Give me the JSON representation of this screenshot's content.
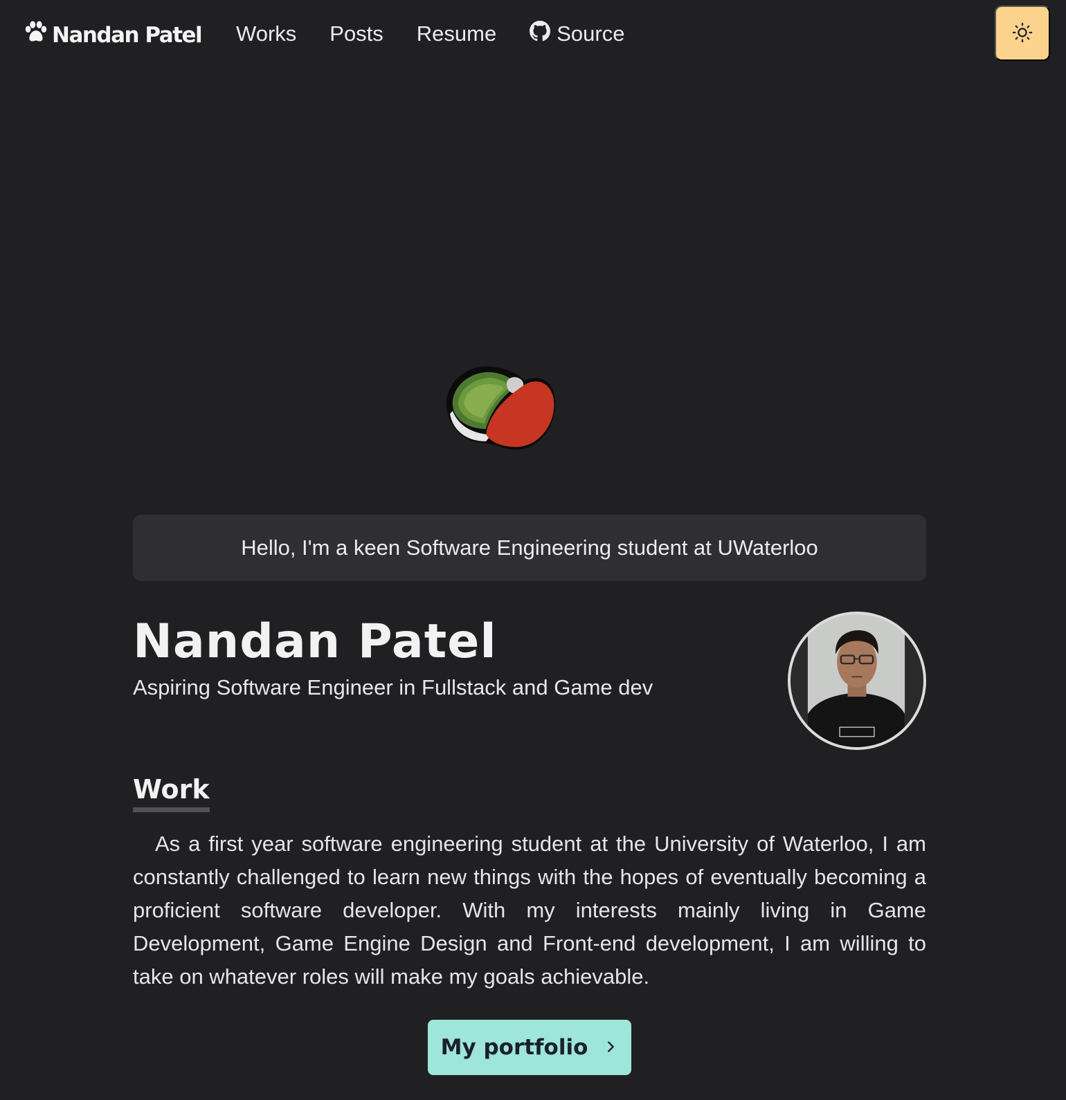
{
  "nav": {
    "logo_text": "Nandan Patel",
    "logo_icon": "paw-icon",
    "links": [
      {
        "label": "Works"
      },
      {
        "label": "Posts"
      },
      {
        "label": "Resume"
      },
      {
        "label": "Source",
        "icon": "github-icon"
      }
    ],
    "theme_toggle_icon": "sun-icon"
  },
  "hero": {
    "greeting": "Hello, I'm a keen Software Engineering student at UWaterloo"
  },
  "profile": {
    "name": "Nandan Patel",
    "tagline": "Aspiring Software Engineer in Fullstack and Game dev"
  },
  "work": {
    "heading": "Work",
    "paragraph": "As a first year software engineering student at the University of Waterloo, I am constantly challenged to learn new things with the hopes of eventually becoming a proficient software developer. With my interests mainly living in Game Development, Game Engine Design and Front-end development, I am willing to take on whatever roles will make my goals achievable.",
    "button_label": "My portfolio"
  },
  "colors": {
    "background": "#202023",
    "toggle_bg": "#fbd38d",
    "button_bg": "#9ee6d9",
    "greeting_bg": "#2f2f33"
  }
}
